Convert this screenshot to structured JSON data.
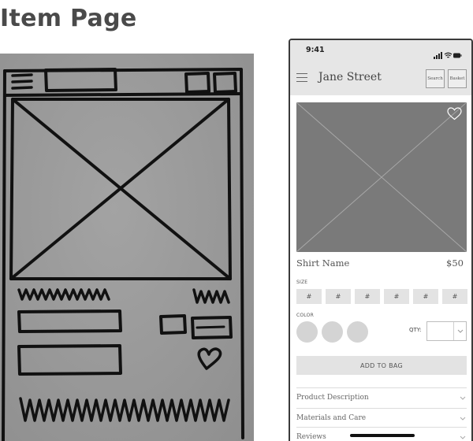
{
  "page_title": "Item Page",
  "phone": {
    "status_time": "9:41",
    "header": {
      "store_name": "Jane Street",
      "search_label": "Search",
      "basket_label": "Basket"
    },
    "product": {
      "name": "Shirt Name",
      "price": "$50"
    },
    "size": {
      "label": "SIZE",
      "options": [
        "#",
        "#",
        "#",
        "#",
        "#",
        "#"
      ]
    },
    "color": {
      "label": "COLOR",
      "swatch_count": 3
    },
    "quantity": {
      "label": "QTY:",
      "value": ""
    },
    "add_to_bag_label": "ADD TO BAG",
    "accordion": [
      "Product Description",
      "Materials and Care",
      "Reviews"
    ]
  },
  "colors": {
    "image_placeholder": "#7a7a7a",
    "header_bg": "#e6e6e6",
    "button_bg": "#e3e3e3",
    "sketch_paper": "#989898"
  }
}
